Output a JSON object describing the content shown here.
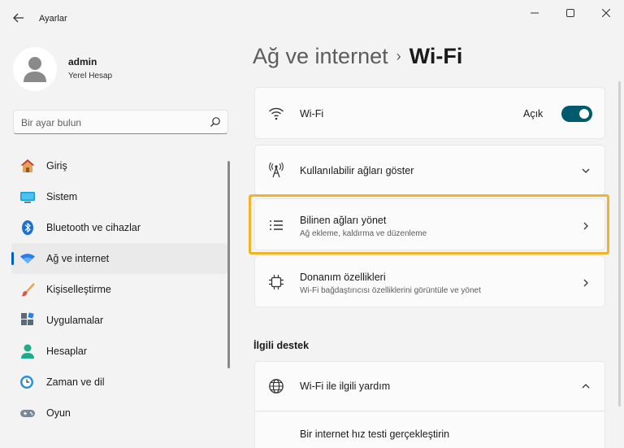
{
  "window": {
    "title": "Ayarlar"
  },
  "profile": {
    "name": "admin",
    "account_type": "Yerel Hesap"
  },
  "search": {
    "placeholder": "Bir ayar bulun"
  },
  "sidebar": {
    "items": [
      {
        "label": "Giriş",
        "icon": "home-icon"
      },
      {
        "label": "Sistem",
        "icon": "system-icon"
      },
      {
        "label": "Bluetooth ve cihazlar",
        "icon": "bluetooth-icon"
      },
      {
        "label": "Ağ ve internet",
        "icon": "network-icon",
        "active": true
      },
      {
        "label": "Kişiselleştirme",
        "icon": "brush-icon"
      },
      {
        "label": "Uygulamalar",
        "icon": "apps-icon"
      },
      {
        "label": "Hesaplar",
        "icon": "accounts-icon"
      },
      {
        "label": "Zaman ve dil",
        "icon": "clock-globe-icon"
      },
      {
        "label": "Oyun",
        "icon": "gamepad-icon"
      }
    ]
  },
  "breadcrumb": {
    "parent": "Ağ ve internet",
    "separator": "›",
    "current": "Wi-Fi"
  },
  "wifi": {
    "label": "Wi-Fi",
    "state": "Açık",
    "enabled": true
  },
  "available": {
    "label": "Kullanılabilir ağları göster"
  },
  "known": {
    "label": "Bilinen ağları yönet",
    "description": "Ağ ekleme, kaldırma ve düzenleme"
  },
  "hardware": {
    "label": "Donanım özellikleri",
    "description": "Wi-Fi bağdaştırıcısı özelliklerini görüntüle ve yönet"
  },
  "related": {
    "title": "İlgili destek",
    "help_label": "Wi-Fi ile ilgili yardım",
    "speed_test": "Bir internet hız testi gerçekleştirin"
  },
  "colors": {
    "accent": "#005fb8",
    "toggle_on": "#005a6e",
    "highlight": "#f0b429"
  }
}
